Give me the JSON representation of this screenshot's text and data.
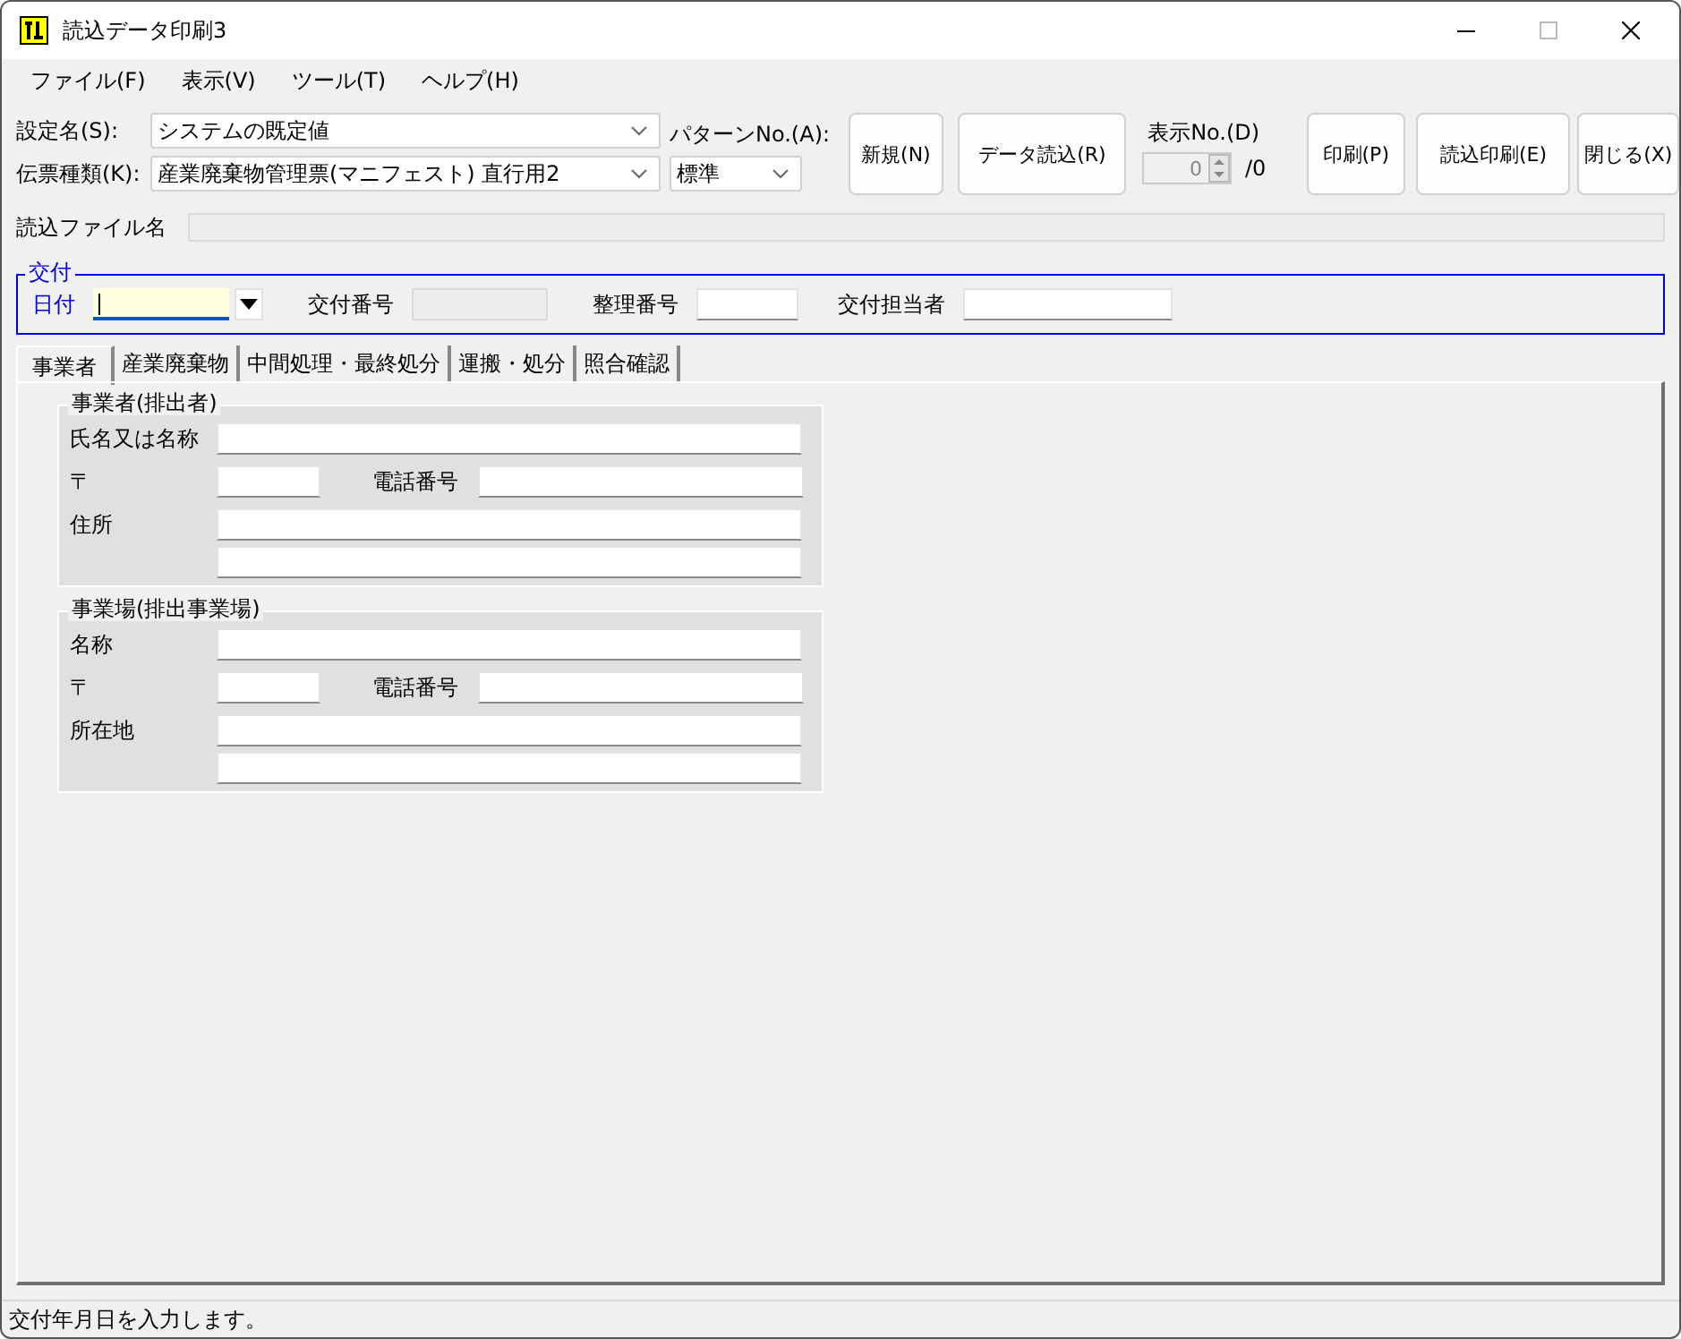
{
  "window": {
    "title": "読込データ印刷3"
  },
  "menu": [
    "ファイル(F)",
    "表示(V)",
    "ツール(T)",
    "ヘルプ(H)"
  ],
  "settings": [
    {
      "label": "設定名(S):",
      "value": "システムの既定値"
    },
    {
      "label": "伝票種類(K):",
      "value": "産業廃棄物管理票(マニフェスト) 直行用2"
    }
  ],
  "pattern": {
    "label": "パターンNo.(A):",
    "value": "標準"
  },
  "buttons_left": [
    "新規(N)",
    "データ読込(R)"
  ],
  "display_no": {
    "label": "表示No.(D)",
    "value": "0",
    "total": "/0",
    "disabled": true
  },
  "buttons_right": [
    "印刷(P)",
    "読込印刷(E)",
    "閉じる(X)"
  ],
  "file_name": {
    "label": "読込ファイル名",
    "disabled": true
  },
  "issue_group": {
    "title": "交付",
    "fields": [
      {
        "label": "日付",
        "kind": "date",
        "focused": true,
        "disabled": false
      },
      {
        "label": "交付番号",
        "kind": "text",
        "focused": false,
        "disabled": true
      },
      {
        "label": "整理番号",
        "kind": "text",
        "focused": false,
        "disabled": false
      },
      {
        "label": "交付担当者",
        "kind": "text",
        "focused": false,
        "disabled": false
      }
    ]
  },
  "tabs": [
    {
      "label": "事業者",
      "selected": true
    },
    {
      "label": "産業廃棄物",
      "selected": false
    },
    {
      "label": "中間処理・最終処分",
      "selected": false
    },
    {
      "label": "運搬・処分",
      "selected": false
    },
    {
      "label": "照合確認",
      "selected": false
    }
  ],
  "sections": [
    {
      "title": "事業者(排出者)",
      "rows": [
        {
          "kind": "single",
          "label": "氏名又は名称"
        },
        {
          "kind": "postal",
          "label": "〒",
          "phone_label": "電話番号"
        },
        {
          "kind": "double",
          "label": "住所"
        }
      ]
    },
    {
      "title": "事業場(排出事業場)",
      "rows": [
        {
          "kind": "single",
          "label": "名称"
        },
        {
          "kind": "postal",
          "label": "〒",
          "phone_label": "電話番号"
        },
        {
          "kind": "double",
          "label": "所在地"
        }
      ]
    }
  ],
  "status_bar": "交付年月日を入力します。"
}
